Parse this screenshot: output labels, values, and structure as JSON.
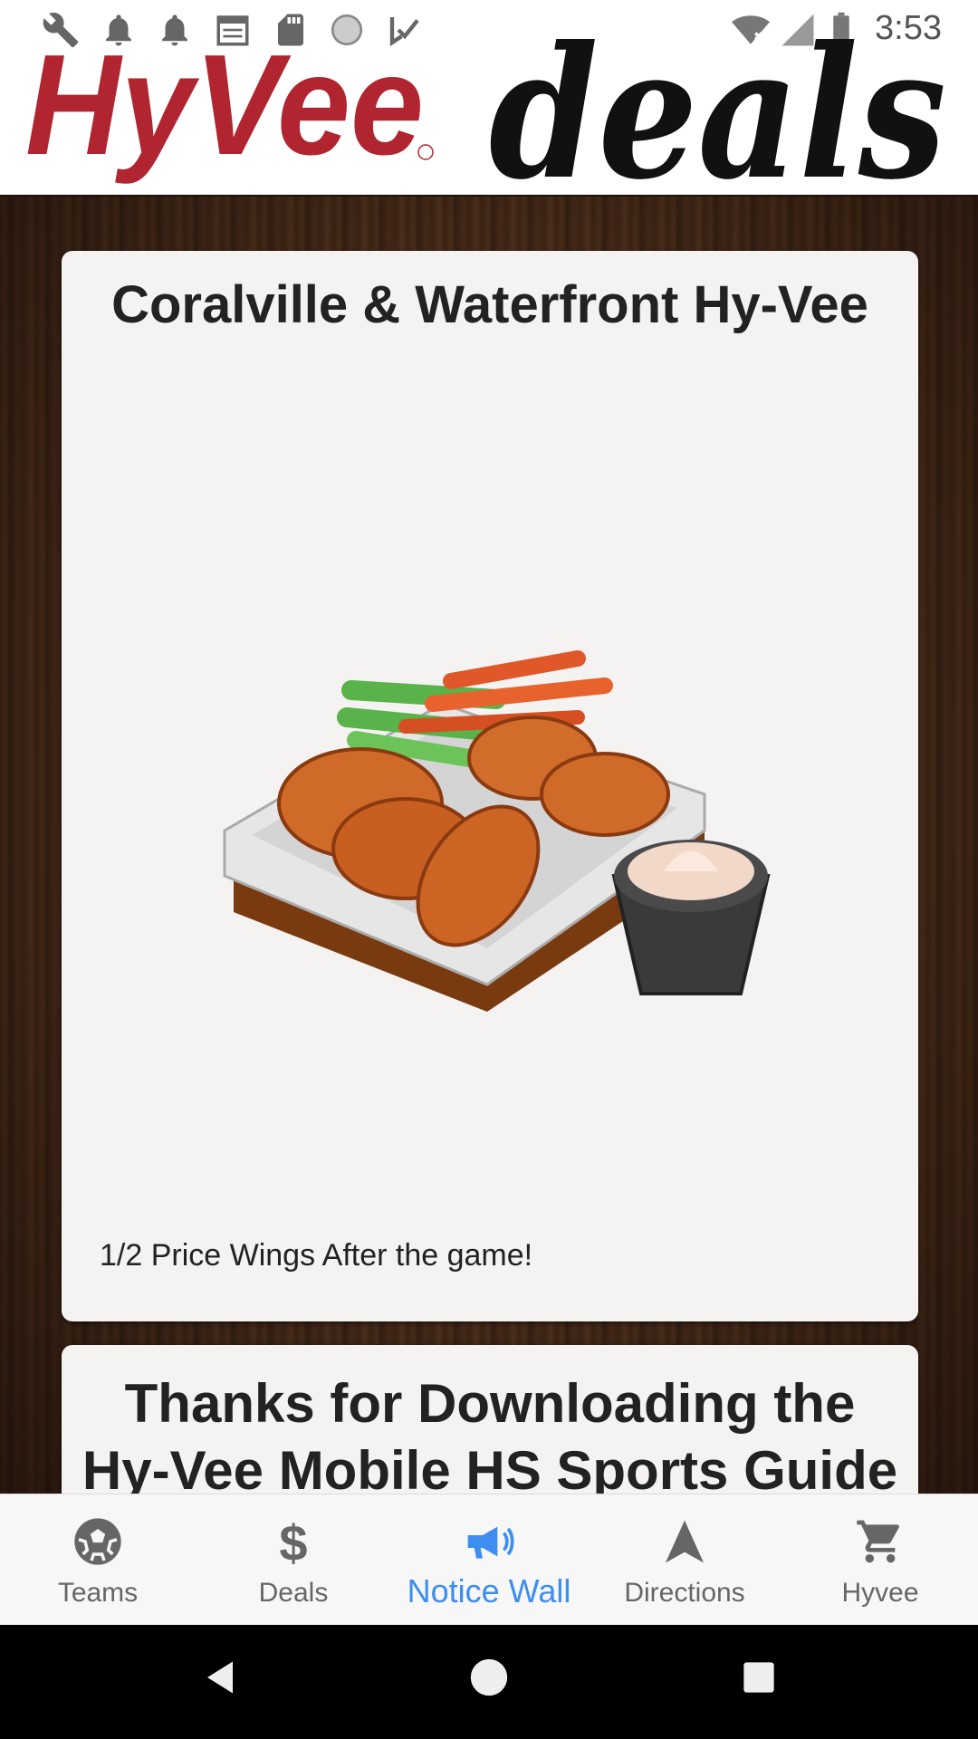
{
  "status_bar": {
    "time": "3:53"
  },
  "header": {
    "logo_left": "HyVee",
    "logo_right": "deals"
  },
  "cards": [
    {
      "title": "Coralville & Waterfront Hy-Vee",
      "caption": "1/2 Price Wings After the game!"
    },
    {
      "title": "Thanks for Downloading the Hy-Vee Mobile HS Sports Guide"
    }
  ],
  "bottom_nav": {
    "active": "Notice Wall",
    "items": [
      {
        "label": "Teams",
        "icon": "soccer-ball-icon"
      },
      {
        "label": "Deals",
        "icon": "dollar-icon"
      },
      {
        "label": "Notice Wall",
        "icon": "megaphone-icon"
      },
      {
        "label": "Directions",
        "icon": "navigation-arrow-icon"
      },
      {
        "label": "Hyvee",
        "icon": "cart-icon"
      }
    ]
  },
  "colors": {
    "active": "#3d8ef0",
    "brand_red": "#b0252f"
  }
}
